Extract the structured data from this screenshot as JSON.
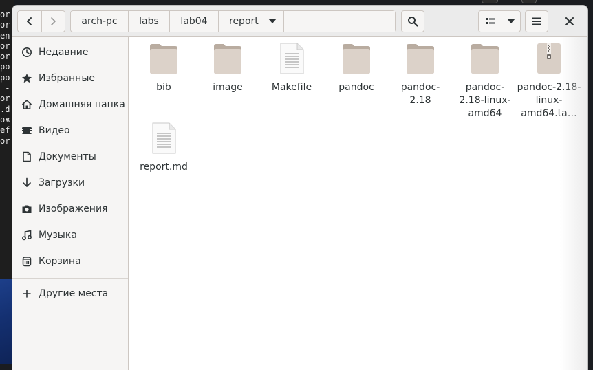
{
  "terminal": {
    "lines": [
      "or",
      "or",
      "en",
      "or",
      "or",
      "po",
      "po",
      " -",
      "or",
      ".d",
      "ож",
      "ef",
      "or"
    ]
  },
  "headerbar": {
    "path": [
      "arch-pc",
      "labs",
      "lab04",
      "report"
    ],
    "back_icon": "chevron-left-icon",
    "forward_icon": "chevron-right-icon",
    "search_icon": "search-icon",
    "view_icon": "list-view-icon",
    "view_dropdown_icon": "chevron-down-icon",
    "menu_icon": "hamburger-menu-icon",
    "close_icon": "close-icon"
  },
  "sidebar": {
    "items": [
      {
        "label": "Недавние",
        "icon": "clock-icon"
      },
      {
        "label": "Избранные",
        "icon": "star-icon"
      },
      {
        "label": "Домашняя папка",
        "icon": "home-icon"
      },
      {
        "label": "Видео",
        "icon": "video-icon"
      },
      {
        "label": "Документы",
        "icon": "document-icon"
      },
      {
        "label": "Загрузки",
        "icon": "download-icon"
      },
      {
        "label": "Изображения",
        "icon": "camera-icon"
      },
      {
        "label": "Музыка",
        "icon": "music-icon"
      },
      {
        "label": "Корзина",
        "icon": "trash-icon"
      }
    ],
    "other_places": {
      "label": "Другие места",
      "icon": "plus-icon"
    }
  },
  "files": [
    {
      "name": "bib",
      "type": "folder"
    },
    {
      "name": "image",
      "type": "folder"
    },
    {
      "name": "Makefile",
      "type": "text"
    },
    {
      "name": "pandoc",
      "type": "folder"
    },
    {
      "name": "pandoc-2.18",
      "type": "folder"
    },
    {
      "name": "pandoc-2.18-linux-amd64",
      "type": "folder"
    },
    {
      "name": "pandoc-2.18-linux-amd64.ta…",
      "type": "archive"
    },
    {
      "name": "report.md",
      "type": "text"
    }
  ],
  "colors": {
    "folder": "#d9cfc6",
    "folder_dark": "#b9aca0",
    "accent": "#2e3436"
  }
}
